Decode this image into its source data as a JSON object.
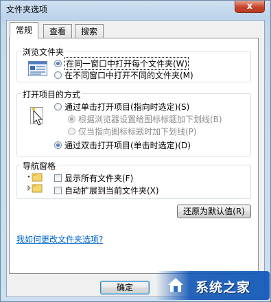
{
  "window": {
    "title": "文件夹选项",
    "close": "x"
  },
  "tabs": [
    {
      "label": "常规",
      "active": true
    },
    {
      "label": "查看",
      "active": false
    },
    {
      "label": "搜索",
      "active": false
    }
  ],
  "browse": {
    "label": "浏览文件夹",
    "opt_same": "在同一窗口中打开每个文件夹(W)",
    "opt_new": "在不同窗口中打开不同的文件夹(M)",
    "selected": "opt_same"
  },
  "click": {
    "label": "打开项目的方式",
    "opt_single": "通过单击打开项目(指向时选定)(S)",
    "opt_underline_browser": "根据浏览器设置给图标标题加下划线(B)",
    "opt_underline_point": "仅当指向图标标题时加下划线(P)",
    "opt_double": "通过双击打开项目(单击时选定)(D)",
    "selected": "opt_double"
  },
  "nav": {
    "label": "导航窗格",
    "show_all": "显示所有文件夹(F)",
    "auto_expand": "自动扩展到当前文件夹(X)",
    "show_all_checked": false,
    "auto_expand_checked": false
  },
  "buttons": {
    "restore": "还原为默认值(R)",
    "ok": "确定"
  },
  "help_link": "我如何更改文件夹选项?",
  "watermark": {
    "text": "系统之家"
  }
}
